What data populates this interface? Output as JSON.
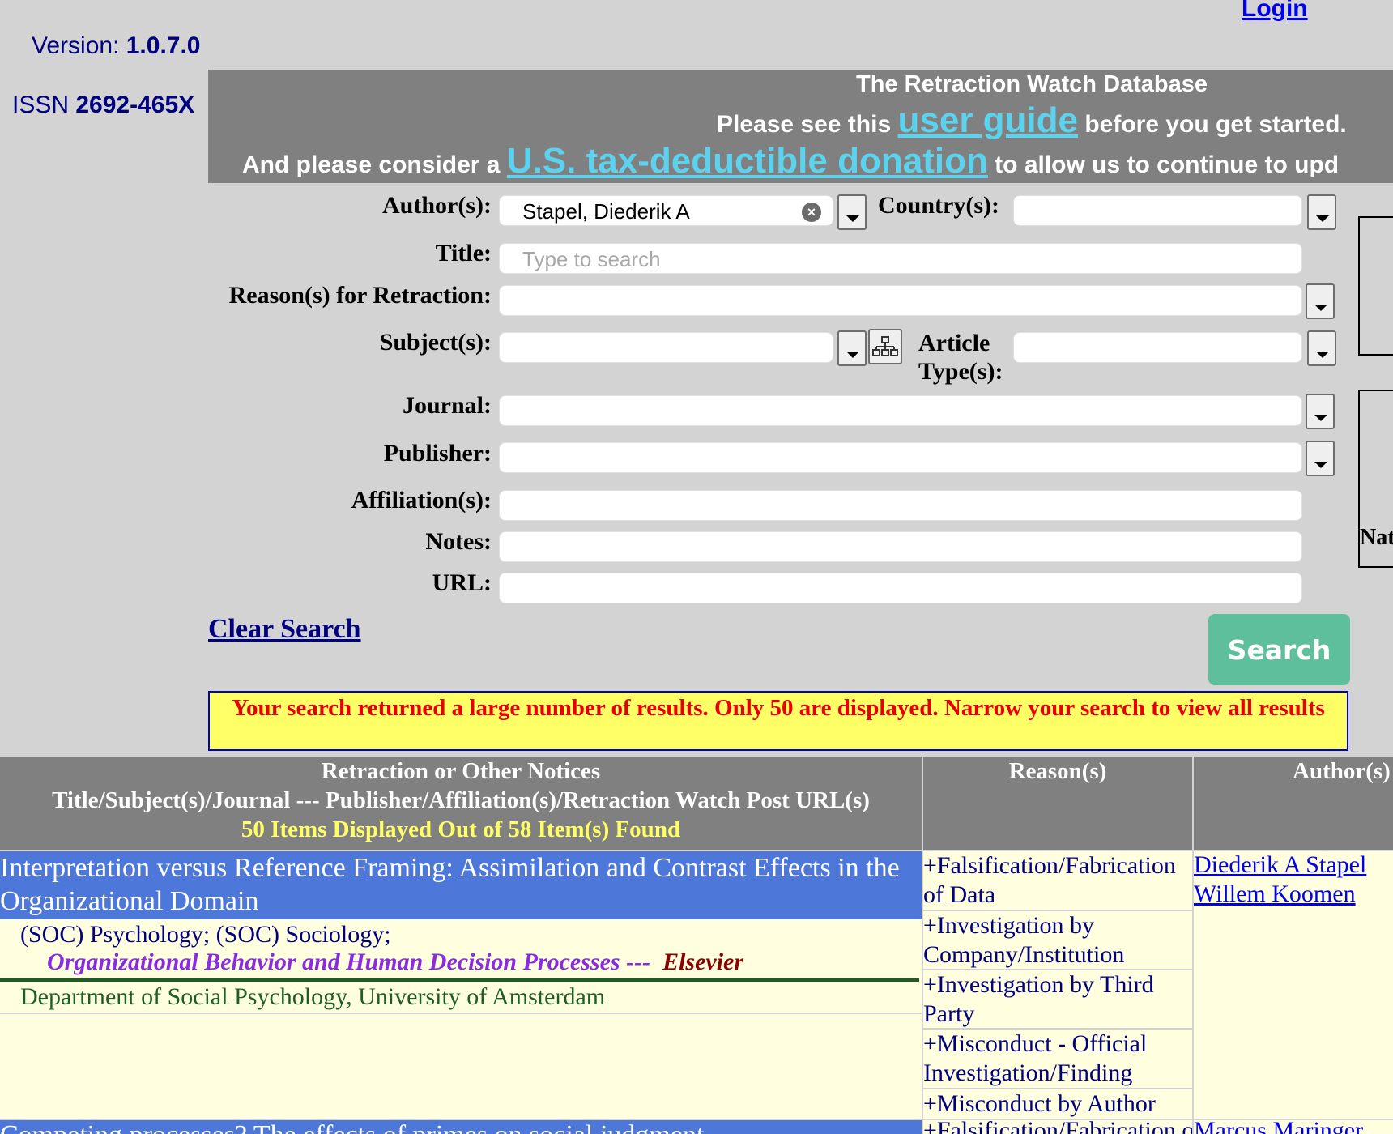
{
  "header": {
    "version_label": "Version:",
    "version": "1.0.7.0",
    "issn_label": "ISSN",
    "issn": "2692-465X",
    "login": "Login"
  },
  "banner": {
    "title": "The Retraction Watch Database",
    "guide_pre": "Please see this",
    "guide_link": "user guide",
    "guide_post": "before you get started.",
    "donate_pre": "And please consider a",
    "donate_link": "U.S. tax-deductible donation",
    "donate_post": "to allow us to continue to upd"
  },
  "form": {
    "author_label": "Author(s):",
    "author_value": "Stapel, Diederik A",
    "country_label": "Country(s):",
    "title_label": "Title:",
    "title_placeholder": "Type to search",
    "reason_label": "Reason(s) for Retraction:",
    "subject_label": "Subject(s):",
    "article_type_label_1": "Article",
    "article_type_label_2": "Type(s):",
    "journal_label": "Journal:",
    "publisher_label": "Publisher:",
    "affiliation_label": "Affiliation(s):",
    "notes_label": "Notes:",
    "url_label": "URL:",
    "right_box_text": "Nat",
    "clear_search": "Clear Search",
    "search_button": "Search"
  },
  "warning": "Your search returned a large number of results. Only 50 are displayed. Narrow your search to view all results",
  "table": {
    "col1_line1": "Retraction or Other Notices",
    "col1_line2": "Title/Subject(s)/Journal --- Publisher/Affiliation(s)/Retraction Watch Post URL(s)",
    "col1_line3": "50 Items Displayed Out of 58 Item(s) Found",
    "col2": "Reason(s)",
    "col3": "Author(s)",
    "rows": [
      {
        "title": "Interpretation versus Reference Framing: Assimilation and Contrast Effects in the Organizational Domain",
        "subjects": "(SOC) Psychology; (SOC) Sociology;",
        "journal": "Organizational Behavior and Human Decision Processes",
        "separator": "---",
        "publisher": "Elsevier",
        "affiliation": "Department of Social Psychology, University of Amsterdam",
        "reasons": [
          "+Falsification/Fabrication of Data",
          "+Investigation by Company/Institution",
          "+Investigation by Third Party",
          "+Misconduct - Official Investigation/Finding",
          "+Misconduct by Author"
        ],
        "authors": [
          "Diederik A Stapel",
          "Willem Koomen"
        ]
      },
      {
        "title": "Competing processes? The effects of primes on social judgment",
        "reason": "+Falsification/Fabrication of Data",
        "author": "Marcus Maringer"
      }
    ]
  }
}
